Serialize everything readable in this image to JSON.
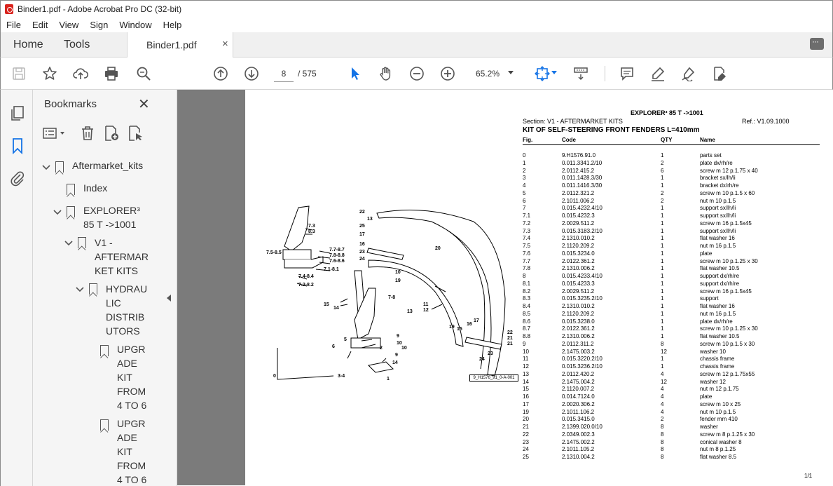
{
  "window": {
    "title": "Binder1.pdf - Adobe Acrobat Pro DC (32-bit)"
  },
  "menu": [
    "File",
    "Edit",
    "View",
    "Sign",
    "Window",
    "Help"
  ],
  "tabs": {
    "home": "Home",
    "tools": "Tools",
    "document": "Binder1.pdf",
    "close": "×"
  },
  "toolbar": {
    "page_current": "8",
    "page_total": "/  575",
    "zoom": "65.2%"
  },
  "bookmarks": {
    "title": "Bookmarks",
    "close": "✕",
    "items": [
      {
        "label": "Aftermarket_kits"
      },
      {
        "label": "Index"
      },
      {
        "label_lines": [
          "EXPLORER³",
          "85 T ->1001"
        ]
      },
      {
        "label_lines": [
          "V1 -",
          "AFTERMAR",
          "KET KITS"
        ]
      },
      {
        "label_lines": [
          "HYDRAU",
          "LIC",
          "DISTRIB",
          "UTORS"
        ]
      },
      {
        "label_lines": [
          "UPGR",
          "ADE",
          "KIT",
          "FROM",
          "4 TO 6"
        ]
      },
      {
        "label_lines": [
          "UPGR",
          "ADE",
          "KIT",
          "FROM",
          "4 TO 6"
        ]
      }
    ]
  },
  "doc": {
    "header_model": "EXPLORER³ 85 T ->1001",
    "header_section": "Section: V1 - AFTERMARKET KITS",
    "header_ref": "Ref.: V1.09.1000",
    "header_title": "KIT OF SELF-STEERING FRONT FENDERS L=410mm",
    "columns": {
      "fig": "Fig.",
      "code": "Code",
      "qty": "QTY",
      "name": "Name"
    },
    "rows": [
      [
        "0",
        "9.H1576.91.0",
        "1",
        "parts set"
      ],
      [
        "1",
        "0.011.3341.2/10",
        "2",
        "plate dx/rh/re"
      ],
      [
        "2",
        "2.0112.415.2",
        "6",
        "screw m 12 p.1.75 x 40"
      ],
      [
        "3",
        "0.011.1428.3/30",
        "1",
        "bracket sx/lh/li"
      ],
      [
        "4",
        "0.011.1416.3/30",
        "1",
        "bracket dx/rh/re"
      ],
      [
        "5",
        "2.0112.321.2",
        "2",
        "screw m 10 p.1.5 x 60"
      ],
      [
        "6",
        "2.1011.006.2",
        "2",
        "nut m 10 p.1.5"
      ],
      [
        "7",
        "0.015.4232.4/10",
        "1",
        "support sx/lh/li"
      ],
      [
        "7.1",
        "0.015.4232.3",
        "1",
        "support sx/lh/li"
      ],
      [
        "7.2",
        "2.0029.511.2",
        "1",
        "screw m 16 p.1.5x45"
      ],
      [
        "7.3",
        "0.015.3183.2/10",
        "1",
        "support sx/lh/li"
      ],
      [
        "7.4",
        "2.1310.010.2",
        "1",
        "flat washer 16"
      ],
      [
        "7.5",
        "2.1120.209.2",
        "1",
        "nut m 16 p.1.5"
      ],
      [
        "7.6",
        "0.015.3234.0",
        "1",
        "plate"
      ],
      [
        "7.7",
        "2.0122.361.2",
        "1",
        "screw m 10 p.1.25 x 30"
      ],
      [
        "7.8",
        "2.1310.006.2",
        "1",
        "flat washer 10.5"
      ],
      [
        "8",
        "0.015.4233.4/10",
        "1",
        "support dx/rh/re"
      ],
      [
        "8.1",
        "0.015.4233.3",
        "1",
        "support dx/rh/re"
      ],
      [
        "8.2",
        "2.0029.511.2",
        "1",
        "screw m 16 p.1.5x45"
      ],
      [
        "8.3",
        "0.015.3235.2/10",
        "1",
        "support"
      ],
      [
        "8.4",
        "2.1310.010.2",
        "1",
        "flat washer 16"
      ],
      [
        "8.5",
        "2.1120.209.2",
        "1",
        "nut m 16 p.1.5"
      ],
      [
        "8.6",
        "0.015.3238.0",
        "1",
        "plate dx/rh/re"
      ],
      [
        "8.7",
        "2.0122.361.2",
        "1",
        "screw m 10 p.1.25 x 30"
      ],
      [
        "8.8",
        "2.1310.006.2",
        "1",
        "flat washer 10.5"
      ],
      [
        "9",
        "2.0112.311.2",
        "8",
        "screw m 10 p.1.5 x 30"
      ],
      [
        "10",
        "2.1475.003.2",
        "12",
        "washer 10"
      ],
      [
        "11",
        "0.015.3220.2/10",
        "1",
        "chassis frame"
      ],
      [
        "12",
        "0.015.3236.2/10",
        "1",
        "chassis frame"
      ],
      [
        "13",
        "2.0112.420.2",
        "4",
        "screw m 12 p.1.75x55"
      ],
      [
        "14",
        "2.1475.004.2",
        "12",
        "washer 12"
      ],
      [
        "15",
        "2.1120.007.2",
        "4",
        "nut m 12 p.1.75"
      ],
      [
        "16",
        "0.014.7124.0",
        "4",
        "plate"
      ],
      [
        "17",
        "2.0020.306.2",
        "4",
        "screw m 10 x 25"
      ],
      [
        "19",
        "2.1011.106.2",
        "4",
        "nut m 10 p.1.5"
      ],
      [
        "20",
        "0.015.3415.0",
        "2",
        "fender mm 410"
      ],
      [
        "21",
        "2.1399.020.0/10",
        "8",
        "washer"
      ],
      [
        "22",
        "2.0349.002.3",
        "8",
        "screw m 8 p.1.25 x 30"
      ],
      [
        "23",
        "2.1475.002.2",
        "8",
        "conical washer 8"
      ],
      [
        "24",
        "2.1011.105.2",
        "8",
        "nut m 8 p.1.25"
      ],
      [
        "25",
        "2.1310.004.2",
        "8",
        "flat washer 8.5"
      ]
    ],
    "diagram_caption": "9_H1576_91_0-A-001",
    "diagram_labels": [
      "22",
      "13",
      "25",
      "17",
      "16",
      "23",
      "24",
      "10",
      "19",
      "20",
      "7.3",
      "8.3",
      "7.5-8.5",
      "7.7-8.7",
      "7.8-8.8",
      "7.6-8.6",
      "7.1-8.1",
      "7.4-8.4",
      "7.2-8.2",
      "15",
      "14",
      "7-8",
      "11",
      "12",
      "13",
      "10",
      "9",
      "5",
      "6",
      "9",
      "10",
      "2",
      "14",
      "3-4",
      "1",
      "0",
      "17",
      "16",
      "19",
      "15",
      "22",
      "21",
      "21",
      "23",
      "24"
    ],
    "page_number": "1/1"
  }
}
